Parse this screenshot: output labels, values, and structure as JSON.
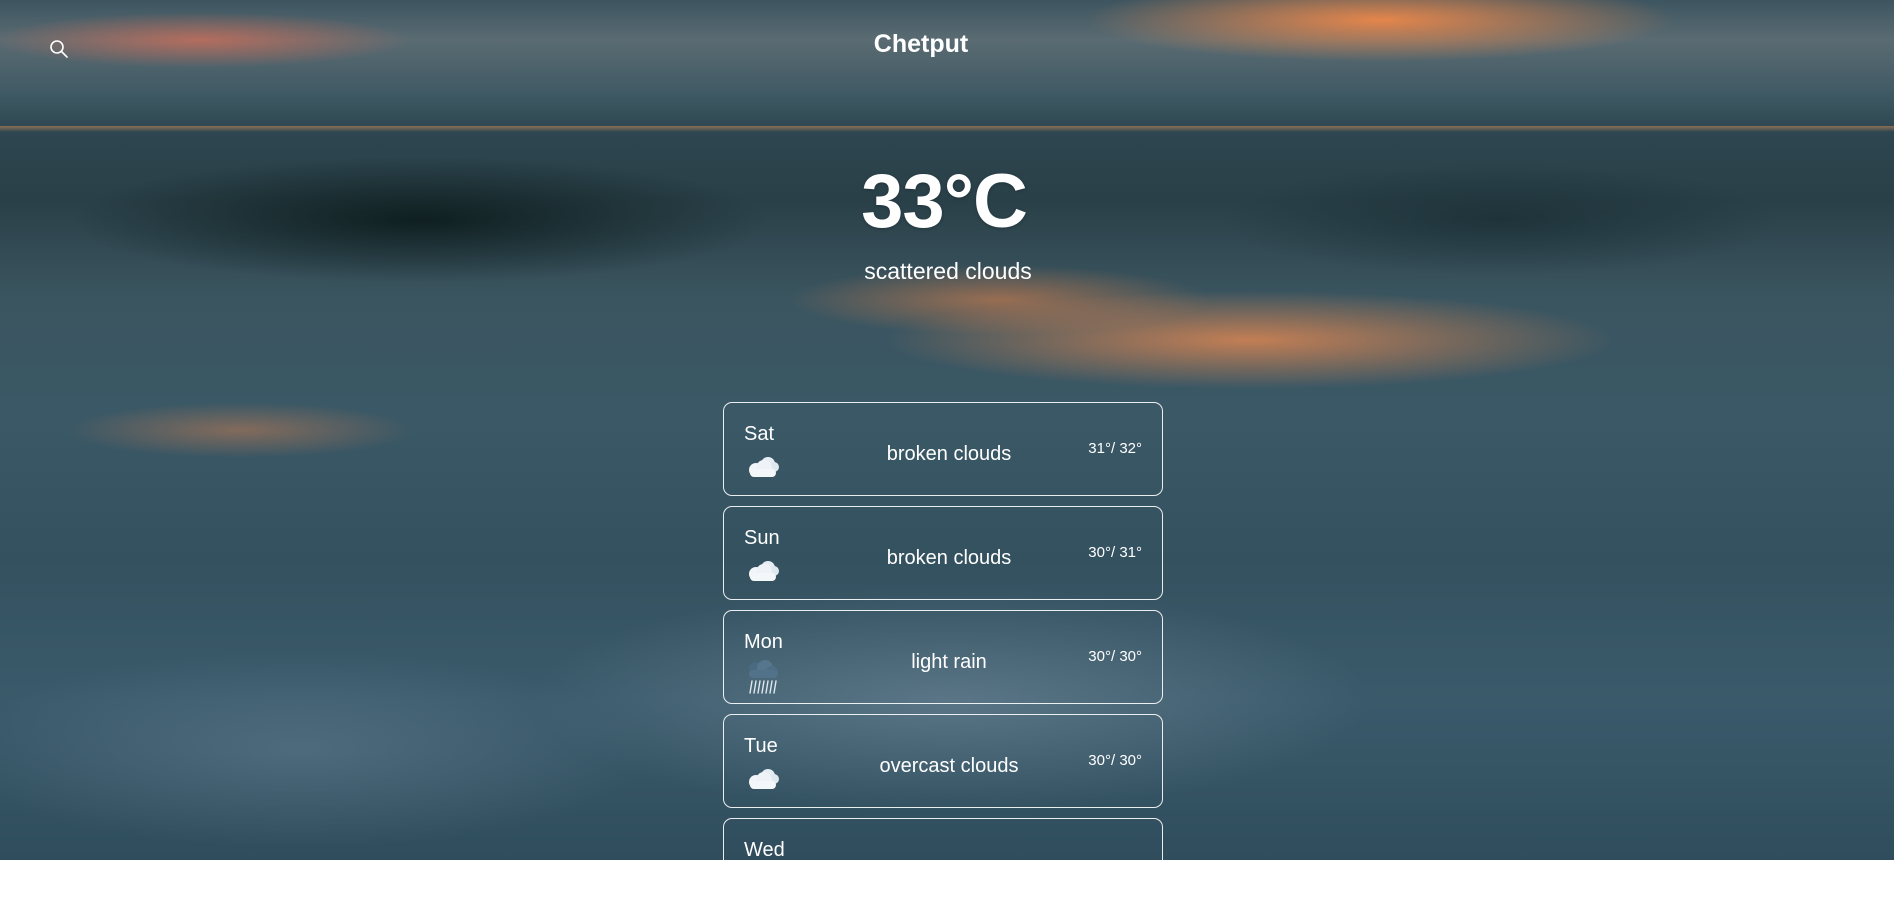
{
  "header": {
    "city": "Chetput",
    "search_icon": "search-icon"
  },
  "current": {
    "temperature": "33°C",
    "description": "scattered clouds"
  },
  "forecast": [
    {
      "day": "Sat",
      "condition": "broken clouds",
      "range": "31°/ 32°",
      "icon": "clouds-icon"
    },
    {
      "day": "Sun",
      "condition": "broken clouds",
      "range": "30°/ 31°",
      "icon": "clouds-icon"
    },
    {
      "day": "Mon",
      "condition": "light rain",
      "range": "30°/ 30°",
      "icon": "rain-cloud-icon"
    },
    {
      "day": "Tue",
      "condition": "overcast clouds",
      "range": "30°/ 30°",
      "icon": "clouds-icon"
    },
    {
      "day": "Wed",
      "condition": "",
      "range": "",
      "icon": ""
    }
  ]
}
